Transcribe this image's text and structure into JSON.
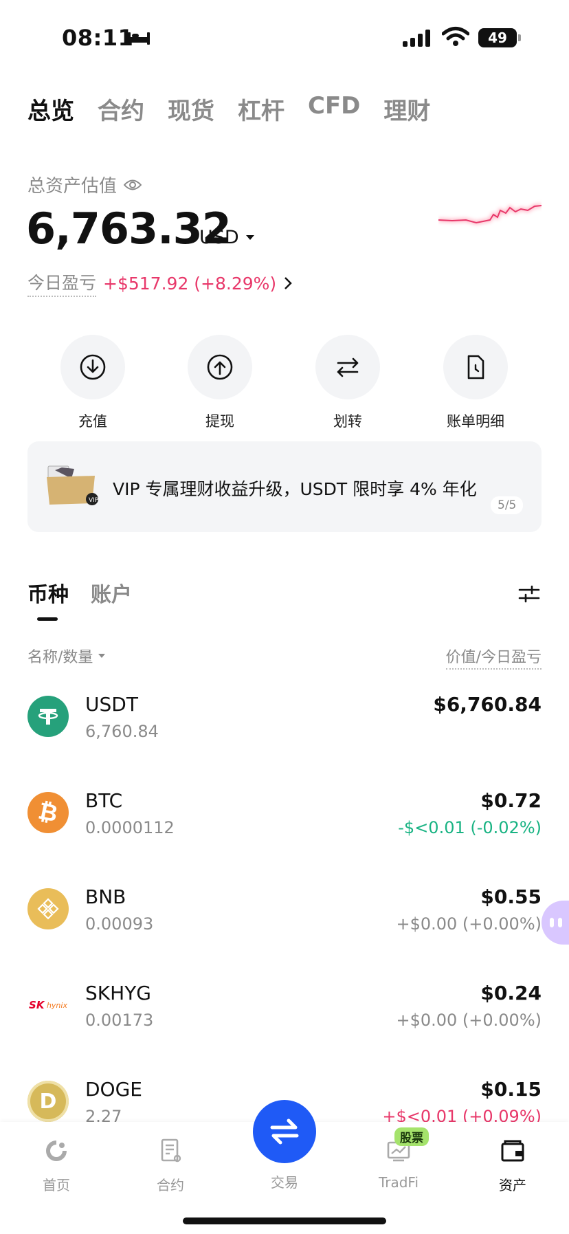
{
  "status_bar": {
    "time": "08:11",
    "battery": "49"
  },
  "top_tabs": [
    {
      "label": "总览",
      "active": true
    },
    {
      "label": "合约"
    },
    {
      "label": "现货"
    },
    {
      "label": "杠杆"
    },
    {
      "label": "CFD"
    },
    {
      "label": "理财"
    }
  ],
  "asset": {
    "label": "总资产估值",
    "balance": "6,763.32",
    "currency": "USD",
    "pnl_label": "今日盈亏",
    "pnl_value": "+$517.92 (+8.29%)"
  },
  "actions": [
    {
      "label": "充值",
      "icon": "deposit-icon"
    },
    {
      "label": "提现",
      "icon": "withdraw-icon"
    },
    {
      "label": "划转",
      "icon": "transfer-icon"
    },
    {
      "label": "账单明细",
      "icon": "bill-icon"
    }
  ],
  "banner": {
    "text": "VIP 专属理财收益升级，USDT 限时享 4% 年化",
    "page": "5/5"
  },
  "asset_tabs": [
    {
      "label": "币种",
      "active": true
    },
    {
      "label": "账户"
    }
  ],
  "columns": {
    "left": "名称/数量",
    "right": "价值/今日盈亏"
  },
  "coins": [
    {
      "symbol": "USDT",
      "qty": "6,760.84",
      "value": "$6,760.84",
      "pnl": "",
      "pnl_type": "zero",
      "color": "#26a17b",
      "glyph": "T"
    },
    {
      "symbol": "BTC",
      "qty": "0.0000112",
      "value": "$0.72",
      "pnl": "-$<0.01 (-0.02%)",
      "pnl_type": "neg",
      "color": "#f08f34",
      "glyph": "₿"
    },
    {
      "symbol": "BNB",
      "qty": "0.00093",
      "value": "$0.55",
      "pnl": "+$0.00 (+0.00%)",
      "pnl_type": "zero",
      "color": "#e9bd59",
      "glyph": "◆"
    },
    {
      "symbol": "SKHYG",
      "qty": "0.00173",
      "value": "$0.24",
      "pnl": "+$0.00 (+0.00%)",
      "pnl_type": "zero",
      "color": "#ffffff",
      "glyph": "SK"
    },
    {
      "symbol": "DOGE",
      "qty": "2.27",
      "value": "$0.15",
      "pnl": "+$<0.01 (+0.09%)",
      "pnl_type": "pos",
      "color": "#d6b95a",
      "glyph": "D"
    }
  ],
  "bottom_nav": [
    {
      "label": "首页",
      "icon": "home-icon"
    },
    {
      "label": "合约",
      "icon": "futures-icon"
    },
    {
      "label": "交易",
      "icon": "trade-icon"
    },
    {
      "label": "TradFi",
      "icon": "tradfi-icon",
      "badge": "股票"
    },
    {
      "label": "资产",
      "icon": "wallet-icon",
      "active": true
    }
  ],
  "colors": {
    "accent": "#1f5af6",
    "positive": "#e8386a",
    "negative": "#19b383"
  }
}
